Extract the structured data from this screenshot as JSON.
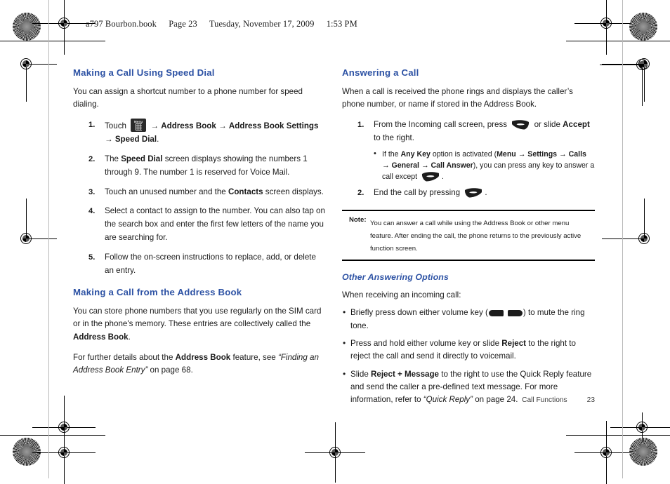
{
  "document": {
    "header_line": "a797 Bourbon.book   Page 23   Tuesday, November 17, 2009   1:53 PM",
    "file_name": "a797 Bourbon.book",
    "page_label": "Page 23",
    "date_label": "Tuesday, November 17, 2009",
    "time_label": "1:53 PM",
    "accent_color": "#2d52a4",
    "text_color": "#1a1a1a"
  },
  "footer": {
    "chapter": "Call Functions",
    "page_number": "23"
  },
  "left_column": {
    "section1": {
      "heading": "Making a Call Using Speed Dial",
      "intro": "You can assign a shortcut number to a phone number for speed dialing.",
      "steps": [
        {
          "num": "1.",
          "lead": "Touch",
          "icon": "menu-key-icon",
          "path_parts": [
            "Address Book",
            "Address Book Settings",
            "Speed Dial"
          ],
          "arrow": "→",
          "trailing": "."
        },
        {
          "num": "2.",
          "pre": "The ",
          "bold": "Speed Dial",
          "post": " screen displays showing the numbers 1 through 9. The number 1 is reserved for Voice Mail."
        },
        {
          "num": "3.",
          "pre": "Touch an unused number and the ",
          "bold": "Contacts",
          "post": " screen displays."
        },
        {
          "num": "4.",
          "pre": "Select a contact to assign to the number. You can also tap on the search box and enter the first few letters of the name you are searching for.",
          "bold": "",
          "post": ""
        },
        {
          "num": "5.",
          "pre": "Follow the on-screen instructions to replace, add, or delete an entry.",
          "bold": "",
          "post": ""
        }
      ]
    },
    "section2": {
      "heading": "Making a Call from the Address Book",
      "para1_pre": "You can store phone numbers that you use regularly on the SIM card or in the phone's memory. These entries are collectively called the ",
      "para1_bold": "Address Book",
      "para1_post": ".",
      "para2_pre": "For further details about the ",
      "para2_bold": "Address Book",
      "para2_mid": " feature, see ",
      "para2_italic": "“Finding an Address Book Entry”",
      "para2_post": " on page 68."
    }
  },
  "right_column": {
    "section1": {
      "heading": "Answering a Call",
      "intro": "When a call is received the phone rings and displays the caller’s phone number, or name if stored in the Address Book.",
      "step1": {
        "num": "1.",
        "lead": "From the Incoming call screen, press",
        "icon": "send-key-icon",
        "mid": "or slide",
        "bold": "Accept",
        "post": "to the right."
      },
      "substep": {
        "pre": "If the ",
        "bold1": "Any Key",
        "mid1": " option is activated (",
        "path": [
          "Menu",
          "Settings",
          "Calls",
          "General",
          "Call Answer"
        ],
        "arrow": "→",
        "mid2": "), you can press any key to answer a call except ",
        "icon": "end-key-icon",
        "post": "."
      },
      "step2": {
        "num": "2.",
        "lead": "End the call by pressing",
        "icon": "end-key-icon",
        "post": "."
      }
    },
    "note": {
      "label": "Note:",
      "text": "You can answer a call while using the Address Book or other menu feature. After ending the call, the phone returns to the previously active function screen."
    },
    "section2": {
      "heading": "Other Answering Options",
      "intro": "When receiving an incoming call:",
      "bullets": [
        {
          "pre": "Briefly press down either volume key (",
          "icon": "volume-key-icon",
          "post": ") to mute the ring tone."
        },
        {
          "pre": "Press and hold either volume key or slide ",
          "bold": "Reject",
          "post": " to the right to reject the call and send it directly to voicemail."
        },
        {
          "pre": "Slide ",
          "bold": "Reject + Message",
          "mid": " to the right to use the Quick Reply feature and send the caller a pre-defined text message. For more information, refer to ",
          "italic": "“Quick Reply”",
          "post": " on page 24."
        }
      ]
    }
  }
}
